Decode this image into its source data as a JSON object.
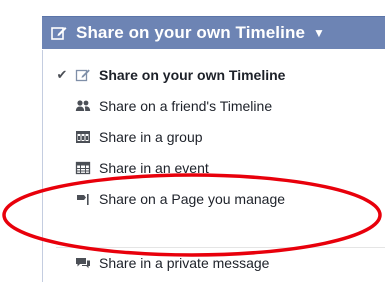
{
  "trigger": {
    "label": "Share on your own Timeline",
    "icon": "compose-icon",
    "caret_icon": "caret-down-icon",
    "background": "#6d84b4"
  },
  "menu": {
    "items": [
      {
        "label": "Share on your own Timeline",
        "icon": "compose-icon",
        "selected": true
      },
      {
        "label": "Share on a friend's Timeline",
        "icon": "friends-icon",
        "selected": false
      },
      {
        "label": "Share in a group",
        "icon": "group-icon",
        "selected": false
      },
      {
        "label": "Share in an event",
        "icon": "calendar-icon",
        "selected": false
      },
      {
        "label": "Share on a Page you manage",
        "icon": "flag-icon",
        "selected": false
      },
      {
        "label": "Share in a private message",
        "icon": "message-icon",
        "selected": false
      }
    ]
  },
  "annotation": {
    "type": "ellipse-highlight",
    "color": "#e8000b",
    "target": "Share on a Page you manage"
  }
}
